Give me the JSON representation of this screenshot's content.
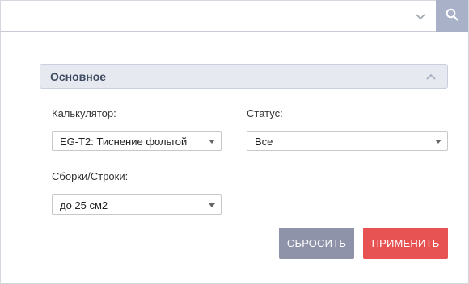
{
  "search": {
    "value": "",
    "placeholder": "",
    "dropdown_icon": "chevron-down-icon",
    "search_icon": "search-icon"
  },
  "section": {
    "title": "Основное",
    "collapse_icon": "chevron-up-icon"
  },
  "fields": {
    "calculator": {
      "label": "Калькулятор:",
      "value": "EG-T2: Тиснение фольгой"
    },
    "status": {
      "label": "Статус:",
      "value": "Все"
    },
    "assemblies": {
      "label": "Сборки/Строки:",
      "value": "до 25 см2"
    }
  },
  "actions": {
    "reset_label": "СБРОСИТЬ",
    "apply_label": "ПРИМЕНИТЬ"
  },
  "colors": {
    "search_button": "#a9b1c8",
    "section_header": "#e6e9ef",
    "reset_button": "#8e93a9",
    "apply_button": "#e75252"
  }
}
